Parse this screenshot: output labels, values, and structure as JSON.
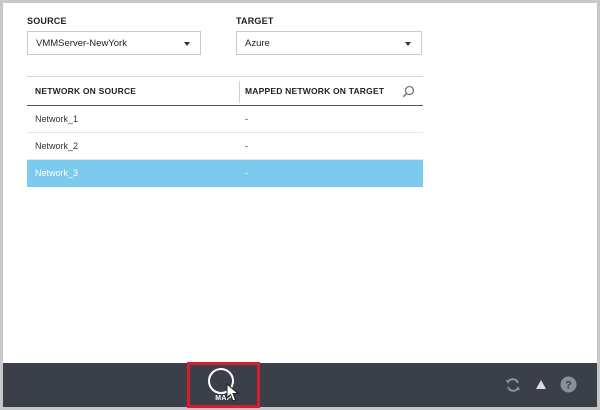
{
  "source": {
    "label": "SOURCE",
    "value": "VMMServer-NewYork"
  },
  "target": {
    "label": "TARGET",
    "value": "Azure"
  },
  "table": {
    "columns": [
      "NETWORK  ON SOURCE",
      "MAPPED  NETWORK ON TARGET"
    ],
    "rows": [
      {
        "source": "Network_1",
        "target": "-",
        "selected": false
      },
      {
        "source": "Network_2",
        "target": "-",
        "selected": false
      },
      {
        "source": "Network_3",
        "target": "-",
        "selected": true
      }
    ]
  },
  "footer": {
    "map_label": "MAP",
    "icons": [
      "refresh-icon",
      "up-arrow-icon",
      "help-icon"
    ]
  },
  "colors": {
    "selected_row": "#7ccbee",
    "footer_bg": "#3a3f49",
    "highlight_border": "#d4202a"
  }
}
